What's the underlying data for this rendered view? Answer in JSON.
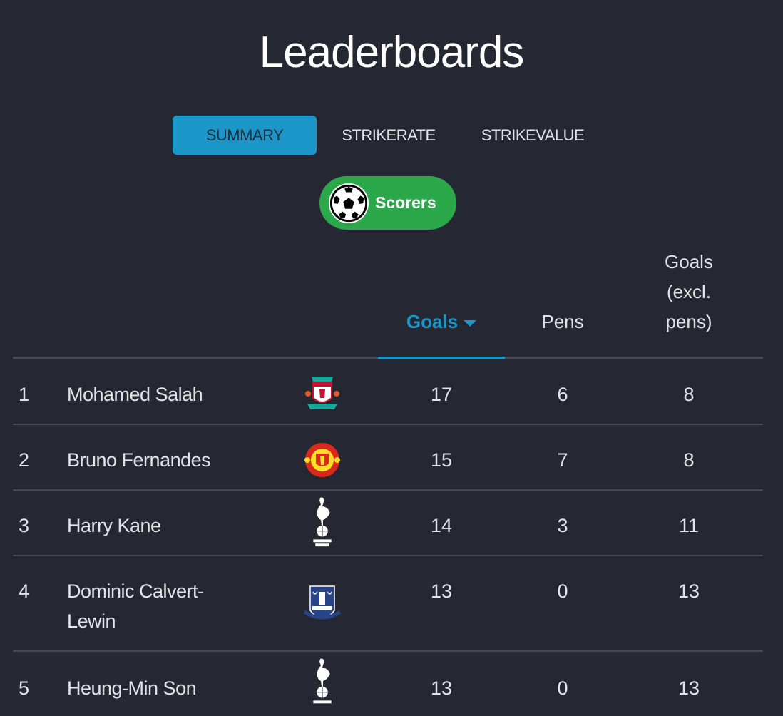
{
  "page": {
    "title": "Leaderboards"
  },
  "tabs": [
    {
      "label": "SUMMARY",
      "active": true
    },
    {
      "label": "STRIKERATE",
      "active": false
    },
    {
      "label": "STRIKEVALUE",
      "active": false
    }
  ],
  "filter": {
    "label": "Scorers",
    "icon": "soccer-ball-icon"
  },
  "colors": {
    "background": "#252832",
    "accent": "#1a96c9",
    "filter_green": "#2ba84a",
    "divider": "#454955"
  },
  "table": {
    "columns": {
      "goals": "Goals",
      "pens": "Pens",
      "excl_line1": "Goals",
      "excl_line2": "(excl.",
      "excl_line3": "pens)"
    },
    "sorted_by": "Goals",
    "sort_direction": "descending",
    "rows": [
      {
        "rank": "1",
        "name": "Mohamed Salah",
        "club": "Liverpool",
        "crest": "liverpool-crest-icon",
        "goals": "17",
        "pens": "6",
        "excl": "8"
      },
      {
        "rank": "2",
        "name": "Bruno Fernandes",
        "club": "Manchester United",
        "crest": "manchester-united-crest-icon",
        "goals": "15",
        "pens": "7",
        "excl": "8"
      },
      {
        "rank": "3",
        "name": "Harry Kane",
        "club": "Tottenham Hotspur",
        "crest": "tottenham-crest-icon",
        "goals": "14",
        "pens": "3",
        "excl": "11"
      },
      {
        "rank": "4",
        "name": "Dominic Calvert-Lewin",
        "club": "Everton",
        "crest": "everton-crest-icon",
        "goals": "13",
        "pens": "0",
        "excl": "13"
      },
      {
        "rank": "5",
        "name": "Heung-Min Son",
        "club": "Tottenham Hotspur",
        "crest": "tottenham-crest-icon",
        "goals": "13",
        "pens": "0",
        "excl": "13"
      }
    ]
  }
}
